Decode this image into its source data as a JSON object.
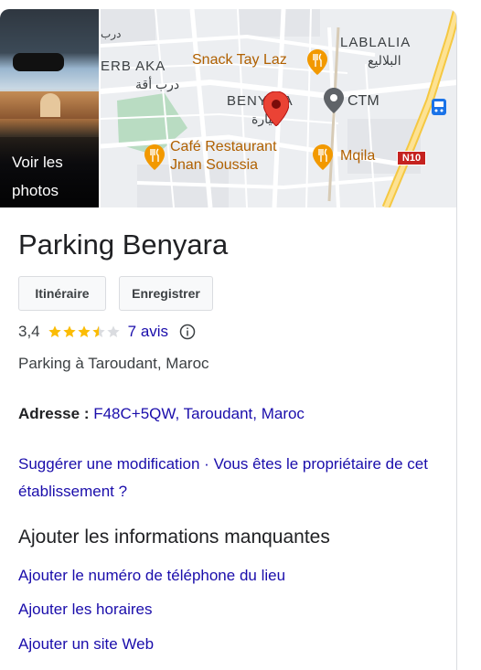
{
  "photo": {
    "label": "Voir les photos"
  },
  "map": {
    "places": [
      {
        "name": "Snack Tay Laz",
        "arabic": "",
        "type": "restaurant"
      },
      {
        "name": "Café Restaurant",
        "name2": "Jnan Soussia",
        "type": "restaurant"
      },
      {
        "name": "Mqila",
        "type": "restaurant"
      },
      {
        "name": "CTM",
        "type": "place"
      }
    ],
    "neighborhoods": {
      "lablalia": "LABLALIA",
      "lablalia_ar": "البلاليع",
      "derbaka": "ERB AKA",
      "derbaka_ar": "درب أقة",
      "benyara": "BENY RA",
      "benyara_ar": "بنيارة",
      "top_ar": "درب"
    },
    "road_badge": "N10",
    "accent_pin": "#ea4335",
    "food_pin": "#f29900",
    "label_food_color": "#b06000",
    "icons": [
      "pin-red-icon",
      "fork-knife-icon",
      "location-pin-icon",
      "bus-icon"
    ]
  },
  "place": {
    "title": "Parking Benyara",
    "buttons": {
      "itinerary": "Itinéraire",
      "save": "Enregistrer"
    },
    "rating": {
      "score": "3,4",
      "stars": 3.4,
      "reviews": "7 avis"
    },
    "category": "Parking à Taroudant, Maroc",
    "address_label": "Adresse :",
    "address_value": "F48C+5QW, Taroudant, Maroc",
    "suggest_text": "Suggérer une modification · Vous êtes le propriétaire de cet établissement ?",
    "missing_title": "Ajouter les informations manquantes",
    "missing_links": [
      "Ajouter le numéro de téléphone du lieu",
      "Ajouter les horaires",
      "Ajouter un site Web"
    ]
  },
  "colors": {
    "link": "#1a0dab",
    "star": "#fbbc04",
    "star_empty": "#dadce0"
  }
}
